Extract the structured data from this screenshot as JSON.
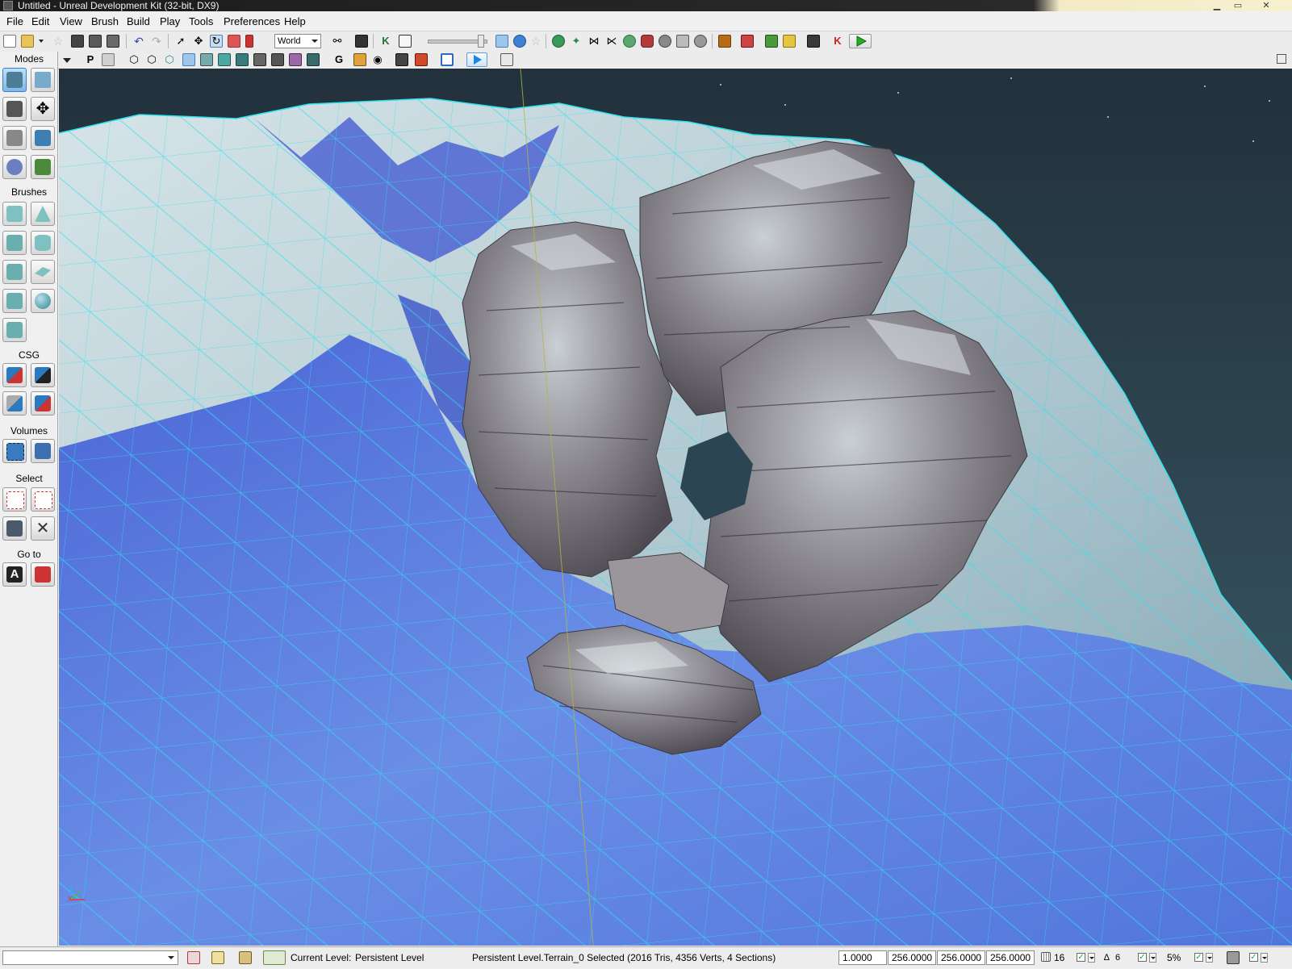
{
  "window": {
    "title": "Untitled - Unreal Development Kit (32-bit, DX9)",
    "minimize_glyph": "▁",
    "maximize_glyph": "▭",
    "close_glyph": "✕"
  },
  "menu": [
    "File",
    "Edit",
    "View",
    "Brush",
    "Build",
    "Play",
    "Tools",
    "Preferences",
    "Help"
  ],
  "toolbar": {
    "coordinate_system": "World"
  },
  "modes_panel": {
    "modes_label": "Modes",
    "brushes_label": "Brushes",
    "csg_label": "CSG",
    "volumes_label": "Volumes",
    "select_label": "Select",
    "goto_label": "Go to"
  },
  "viewport": {
    "axis_z": "Z",
    "axis_x": "x",
    "colors": {
      "sky": "#1f3440",
      "terrain_blue": "#5d7ee0",
      "terrain_light": "#bcd1d7",
      "wire": "#2fe3ee",
      "rock": "#7f7a80"
    }
  },
  "status": {
    "current_level_label": "Current Level:",
    "current_level_value": "Persistent Level",
    "selection_text": "Persistent Level.Terrain_0 Selected (2016 Tris, 4356 Verts, 4 Sections)",
    "drag_scale": "1.0000",
    "grid_x": "256.0000",
    "grid_y": "256.0000",
    "grid_z": "256.0000",
    "grid_size": "16",
    "rotation_snap": "6",
    "scale_snap": "5%"
  }
}
